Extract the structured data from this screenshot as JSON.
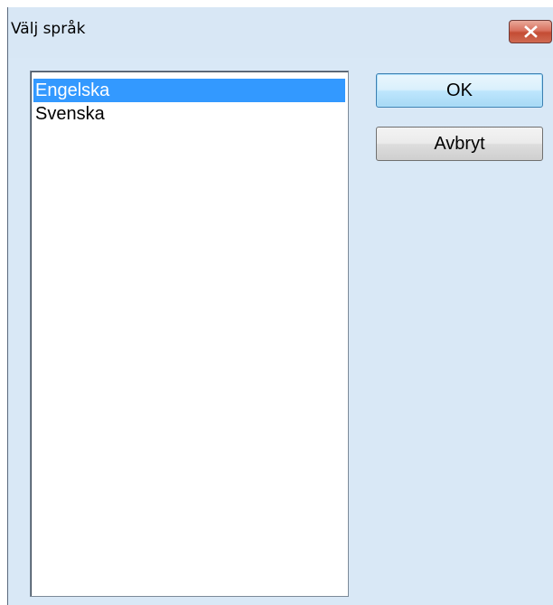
{
  "window": {
    "title": "Välj språk",
    "close_icon": "close-icon"
  },
  "language_list": {
    "items": [
      {
        "label": "Engelska",
        "selected": true
      },
      {
        "label": "Svenska",
        "selected": false
      }
    ]
  },
  "buttons": {
    "ok_label": "OK",
    "cancel_label": "Avbryt"
  },
  "colors": {
    "selection": "#3399ff",
    "dialog_background": "#d9e8f6",
    "close_button": "#c44c34"
  }
}
